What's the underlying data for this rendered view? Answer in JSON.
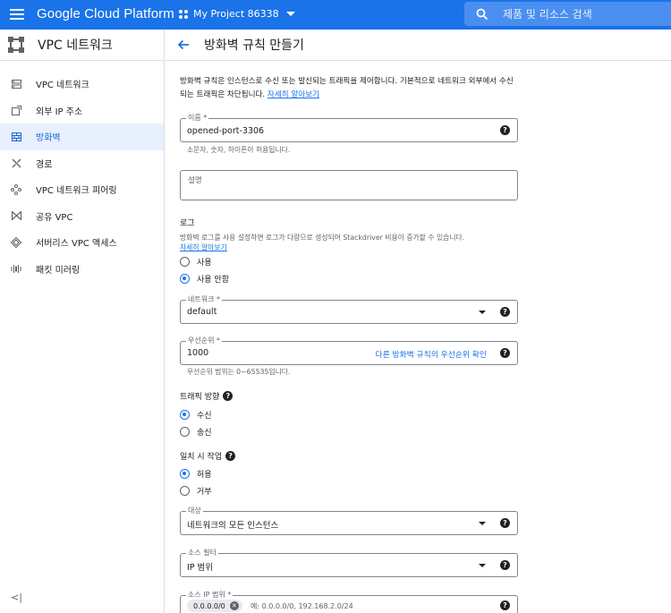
{
  "topbar": {
    "brand": "Google Cloud Platform",
    "project": "My Project 86338",
    "search_placeholder": "제품 및 리소스 검색"
  },
  "sidebar": {
    "title": "VPC 네트워크",
    "items": [
      {
        "label": "VPC 네트워크",
        "icon": "network-icon"
      },
      {
        "label": "외부 IP 주소",
        "icon": "external-ip-icon"
      },
      {
        "label": "방화벽",
        "icon": "firewall-icon",
        "active": true
      },
      {
        "label": "경로",
        "icon": "routes-icon"
      },
      {
        "label": "VPC 네트워크 피어링",
        "icon": "peering-icon"
      },
      {
        "label": "공유 VPC",
        "icon": "shared-vpc-icon"
      },
      {
        "label": "서버리스 VPC 액세스",
        "icon": "serverless-icon"
      },
      {
        "label": "패킷 미러링",
        "icon": "packet-mirroring-icon"
      }
    ],
    "collapse": "<|"
  },
  "header": {
    "title": "방화벽 규칙 만들기"
  },
  "intro": {
    "text": "방화벽 규칙은 인스턴스로 수신 또는 발신되는 트래픽을 제어합니다. 기본적으로 네트워크 외부에서 수신되는 트래픽은 차단됩니다.",
    "link": "자세히 알아보기"
  },
  "form": {
    "name": {
      "label": "이름 *",
      "value": "opened-port-3306",
      "hint": "소문자, 숫자, 하이픈이 허용됩니다."
    },
    "description": {
      "label": "설명",
      "value": ""
    },
    "log": {
      "title": "로그",
      "desc": "방화벽 로그를 사용 설정하면 로그가 다량으로 생성되어 Stackdriver 비용이 증가할 수 있습니다.",
      "link": "자세히 알아보기",
      "options": [
        "사용",
        "사용 안함"
      ],
      "selected": 1
    },
    "network": {
      "label": "네트워크 *",
      "value": "default"
    },
    "priority": {
      "label": "우선순위 *",
      "value": "1000",
      "link": "다른 방화벽 규칙의 우선순위 확인",
      "hint": "우선순위 범위는 0~65535입니다."
    },
    "direction": {
      "title": "트래픽 방향",
      "options": [
        "수신",
        "송신"
      ],
      "selected": 0
    },
    "action": {
      "title": "일치 시 작업",
      "options": [
        "허용",
        "거부"
      ],
      "selected": 0
    },
    "target": {
      "label": "대상",
      "value": "네트워크의 모든 인스턴스"
    },
    "source_filter": {
      "label": "소스 필터",
      "value": "IP 범위"
    },
    "source_ip": {
      "label": "소스 IP 범위 *",
      "chip": "0.0.0.0/0",
      "placeholder": "예: 0.0.0.0/0, 192.168.2.0/24"
    }
  },
  "colors": {
    "primary": "#1a73e8",
    "active_bg": "#e8f0fe",
    "border": "#dadce0"
  }
}
